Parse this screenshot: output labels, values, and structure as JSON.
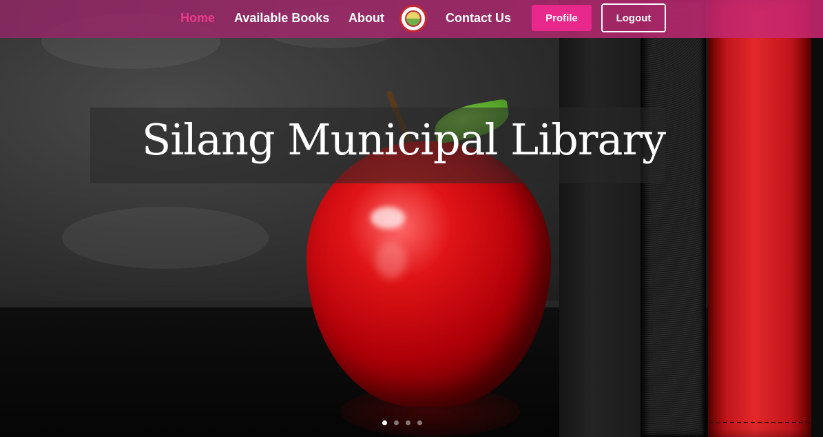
{
  "nav": {
    "links": [
      {
        "label": "Home",
        "active": true
      },
      {
        "label": "Available Books",
        "active": false
      },
      {
        "label": "About",
        "active": false
      },
      {
        "label": "Contact Us",
        "active": false
      }
    ],
    "profile_label": "Profile",
    "logout_label": "Logout",
    "logo_icon": "library-seal-logo"
  },
  "hero": {
    "title": "Silang Municipal Library",
    "slide_count": 4,
    "active_slide": 1
  },
  "colors": {
    "accent": "#e8288a",
    "navbar": "#a8287a",
    "active_link": "#ee3a8c"
  }
}
